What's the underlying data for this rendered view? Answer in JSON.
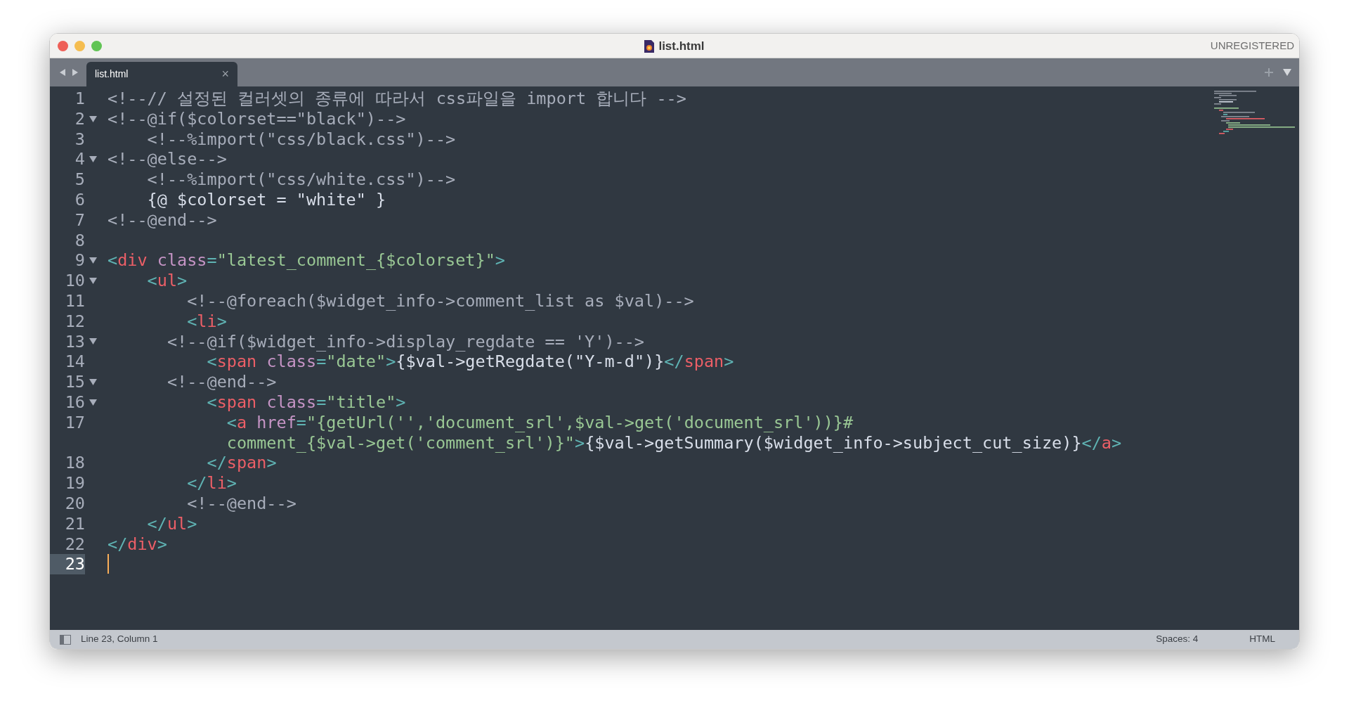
{
  "window": {
    "title": "list.html",
    "registration": "UNREGISTERED"
  },
  "tabs": [
    {
      "label": "list.html",
      "selected": true,
      "close": "×"
    }
  ],
  "code": [
    {
      "number": "1",
      "foldable": false,
      "current": false,
      "tokens": [
        {
          "kind": "comment",
          "text": "<!--// 설정된 컬러셋의 종류에 따라서 css파일을 import 합니다 -->"
        }
      ]
    },
    {
      "number": "2",
      "foldable": true,
      "current": false,
      "tokens": [
        {
          "kind": "comment",
          "text": "<!--@if($colorset==\"black\")-->"
        }
      ]
    },
    {
      "number": "3",
      "foldable": false,
      "current": false,
      "tokens": [
        {
          "kind": "comment",
          "text": "    <!--%import(\"css/black.css\")-->"
        }
      ]
    },
    {
      "number": "4",
      "foldable": true,
      "current": false,
      "tokens": [
        {
          "kind": "comment",
          "text": "<!--@else-->"
        }
      ]
    },
    {
      "number": "5",
      "foldable": false,
      "current": false,
      "tokens": [
        {
          "kind": "comment",
          "text": "    <!--%import(\"css/white.css\")-->"
        }
      ]
    },
    {
      "number": "6",
      "foldable": false,
      "current": false,
      "tokens": [
        {
          "kind": "plain",
          "text": "    {@ $colorset = \"white\" }"
        }
      ]
    },
    {
      "number": "7",
      "foldable": false,
      "current": false,
      "tokens": [
        {
          "kind": "comment",
          "text": "<!--@end-->"
        }
      ]
    },
    {
      "number": "8",
      "foldable": false,
      "current": false
    },
    {
      "number": "9",
      "foldable": true,
      "current": false,
      "tokens": [
        {
          "kind": "punct",
          "text": "<"
        },
        {
          "kind": "tag",
          "text": "div"
        },
        {
          "kind": "attr",
          "text": " class"
        },
        {
          "kind": "punct",
          "text": "="
        },
        {
          "kind": "string",
          "text": "\"latest_comment_{$colorset}\""
        },
        {
          "kind": "punct",
          "text": ">"
        }
      ]
    },
    {
      "number": "10",
      "foldable": true,
      "current": false,
      "tokens": [
        {
          "kind": "punct",
          "text": "    <"
        },
        {
          "kind": "tag",
          "text": "ul"
        },
        {
          "kind": "punct",
          "text": ">"
        }
      ]
    },
    {
      "number": "11",
      "foldable": false,
      "current": false,
      "tokens": [
        {
          "kind": "comment",
          "text": "        <!--@foreach($widget_info->comment_list as $val)-->"
        }
      ]
    },
    {
      "number": "12",
      "foldable": false,
      "current": false,
      "tokens": [
        {
          "kind": "punct",
          "text": "        <"
        },
        {
          "kind": "tag",
          "text": "li"
        },
        {
          "kind": "punct",
          "text": ">"
        }
      ]
    },
    {
      "number": "13",
      "foldable": true,
      "current": false,
      "tokens": [
        {
          "kind": "comment",
          "text": "      <!--@if($widget_info->display_regdate == 'Y')-->"
        }
      ]
    },
    {
      "number": "14",
      "foldable": false,
      "current": false,
      "tokens": [
        {
          "kind": "punct",
          "text": "          <"
        },
        {
          "kind": "tag",
          "text": "span"
        },
        {
          "kind": "attr",
          "text": " class"
        },
        {
          "kind": "punct",
          "text": "="
        },
        {
          "kind": "string",
          "text": "\"date\""
        },
        {
          "kind": "punct",
          "text": ">"
        },
        {
          "kind": "plain",
          "text": "{$val->getRegdate(\"Y-m-d\")}"
        },
        {
          "kind": "punct",
          "text": "</"
        },
        {
          "kind": "tag",
          "text": "span"
        },
        {
          "kind": "punct",
          "text": ">"
        }
      ]
    },
    {
      "number": "15",
      "foldable": true,
      "current": false,
      "tokens": [
        {
          "kind": "comment",
          "text": "      <!--@end-->"
        }
      ]
    },
    {
      "number": "16",
      "foldable": true,
      "current": false,
      "tokens": [
        {
          "kind": "punct",
          "text": "          <"
        },
        {
          "kind": "tag",
          "text": "span"
        },
        {
          "kind": "attr",
          "text": " class"
        },
        {
          "kind": "punct",
          "text": "="
        },
        {
          "kind": "string",
          "text": "\"title\""
        },
        {
          "kind": "punct",
          "text": ">"
        }
      ]
    },
    {
      "number": "17",
      "foldable": false,
      "current": false,
      "tokens": [
        {
          "kind": "punct",
          "text": "            <"
        },
        {
          "kind": "tag",
          "text": "a"
        },
        {
          "kind": "attr",
          "text": " href"
        },
        {
          "kind": "punct",
          "text": "="
        },
        {
          "kind": "string",
          "text": "\"{getUrl('','document_srl',$val->get('document_srl'))}#"
        }
      ],
      "wrapped": [
        {
          "kind": "string",
          "text": "            comment_{$val->get('comment_srl')}\""
        },
        {
          "kind": "punct",
          "text": ">"
        },
        {
          "kind": "plain",
          "text": "{$val->getSummary($widget_info->subject_cut_size)}"
        },
        {
          "kind": "punct",
          "text": "</"
        },
        {
          "kind": "tag",
          "text": "a"
        },
        {
          "kind": "punct",
          "text": ">"
        }
      ]
    },
    {
      "number": "18",
      "foldable": false,
      "current": false,
      "tokens": [
        {
          "kind": "punct",
          "text": "          </"
        },
        {
          "kind": "tag",
          "text": "span"
        },
        {
          "kind": "punct",
          "text": ">"
        }
      ]
    },
    {
      "number": "19",
      "foldable": false,
      "current": false,
      "tokens": [
        {
          "kind": "punct",
          "text": "        </"
        },
        {
          "kind": "tag",
          "text": "li"
        },
        {
          "kind": "punct",
          "text": ">"
        }
      ]
    },
    {
      "number": "20",
      "foldable": false,
      "current": false,
      "tokens": [
        {
          "kind": "comment",
          "text": "        <!--@end-->"
        }
      ]
    },
    {
      "number": "21",
      "foldable": false,
      "current": false,
      "tokens": [
        {
          "kind": "punct",
          "text": "    </"
        },
        {
          "kind": "tag",
          "text": "ul"
        },
        {
          "kind": "punct",
          "text": ">"
        }
      ]
    },
    {
      "number": "22",
      "foldable": false,
      "current": false,
      "tokens": [
        {
          "kind": "punct",
          "text": "</"
        },
        {
          "kind": "tag",
          "text": "div"
        },
        {
          "kind": "punct",
          "text": ">"
        }
      ]
    },
    {
      "number": "23",
      "foldable": false,
      "current": true
    }
  ],
  "status_bar": {
    "position": "Line 23, Column 1",
    "indentation": "Spaces: 4",
    "syntax": "HTML"
  }
}
